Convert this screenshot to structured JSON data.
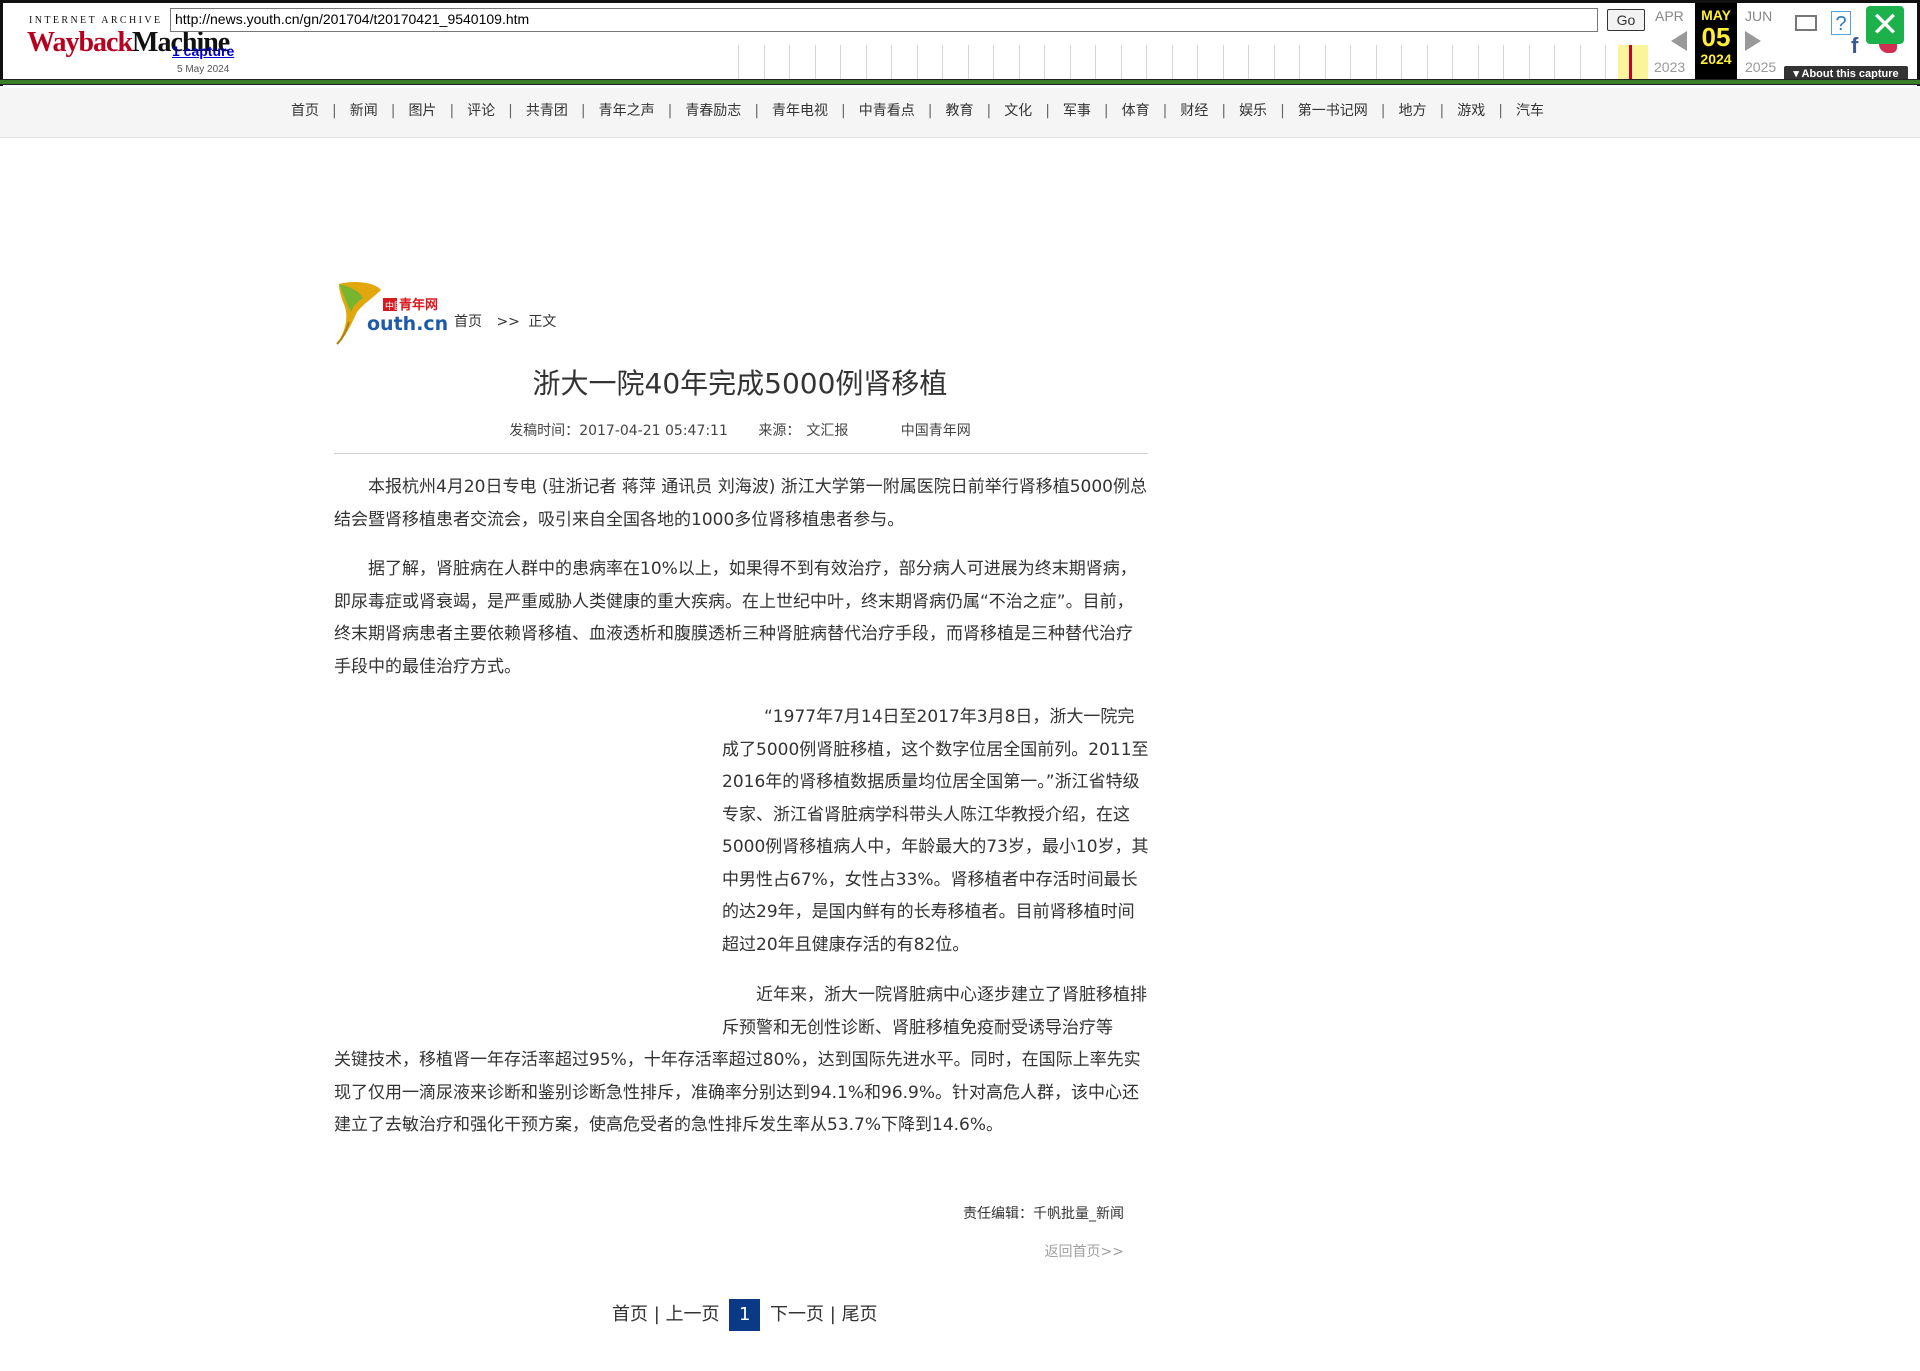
{
  "wayback": {
    "logo_top": "INTERNET ARCHIVE",
    "logo_left": "Wayback",
    "logo_right": "Machine",
    "url": "http://news.youth.cn/gn/201704/t20170421_9540109.htm",
    "go_label": "Go",
    "captures_link": "1 capture",
    "capture_date": "5 May 2024",
    "prev_month": "APR",
    "prev_year": "2023",
    "cur_month": "MAY",
    "cur_day": "05",
    "cur_year": "2024",
    "next_month": "JUN",
    "next_year": "2025",
    "about_label": "▾ About this capture",
    "help_label": "?",
    "close_label": "✕",
    "fb_label": "f"
  },
  "nav": {
    "items": [
      "首页",
      "新闻",
      "图片",
      "评论",
      "共青团",
      "青年之声",
      "青春励志",
      "青年电视",
      "中青看点",
      "教育",
      "文化",
      "军事",
      "体育",
      "财经",
      "娱乐",
      "第一书记网",
      "地方",
      "游戏",
      "汽车"
    ],
    "separator": "|"
  },
  "site": {
    "logo_cn": "中国青年网",
    "logo_en": "outh.cn"
  },
  "breadcrumb": {
    "home": "首页",
    "arrow": ">>",
    "current": "正文"
  },
  "article": {
    "title": "浙大一院40年完成5000例肾移植",
    "publish_label": "发稿时间：",
    "publish_time": "2017-04-21 05:47:11",
    "source_label": "来源：",
    "source": "文汇报",
    "site_name": "中国青年网",
    "p1": "本报杭州4月20日专电 (驻浙记者 蒋萍 通讯员 刘海波) 浙江大学第一附属医院日前举行肾移植5000例总结会暨肾移植患者交流会，吸引来自全国各地的1000多位肾移植患者参与。",
    "p2": "据了解，肾脏病在人群中的患病率在10%以上，如果得不到有效治疗，部分病人可进展为终末期肾病，即尿毒症或肾衰竭，是严重威胁人类健康的重大疾病。在上世纪中叶，终末期肾病仍属“不治之症”。目前，终末期肾病患者主要依赖肾移植、血液透析和腹膜透析三种肾脏病替代治疗手段，而肾移植是三种替代治疗手段中的最佳治疗方式。",
    "p3": "“1977年7月14日至2017年3月8日，浙大一院完成了5000例肾脏移植，这个数字位居全国前列。2011至2016年的肾移植数据质量均位居全国第一。”浙江省特级专家、浙江省肾脏病学科带头人陈江华教授介绍，在这5000例肾移植病人中，年龄最大的73岁，最小10岁，其中男性占67%，女性占33%。肾移植者中存活时间最长的达29年，是国内鲜有的长寿移植者。目前肾移植时间超过20年且健康存活的有82位。",
    "p4a": "近年来，浙大一院肾脏病中心逐步建立了肾脏移植排斥预警和无创性诊断、肾脏移植免疫耐受诱导治疗等",
    "p4b": "关键技术，移植肾一年存活率超过95%，十年存活率超过80%，达到国际先进水平。同时，在国际上率先实现了仅用一滴尿液来诊断和鉴别诊断急性排斥，准确率分别达到94.1%和96.9%。针对高危人群，该中心还建立了去敏治疗和强化干预方案，使高危受者的急性排斥发生率从53.7%下降到14.6%。",
    "editor": "责任编辑：千帆批量_新闻",
    "back_home": "返回首页>>"
  },
  "pager": {
    "first": "首页",
    "prev": "上一页",
    "current": "1",
    "next": "下一页",
    "last": "尾页",
    "sep": "|"
  }
}
